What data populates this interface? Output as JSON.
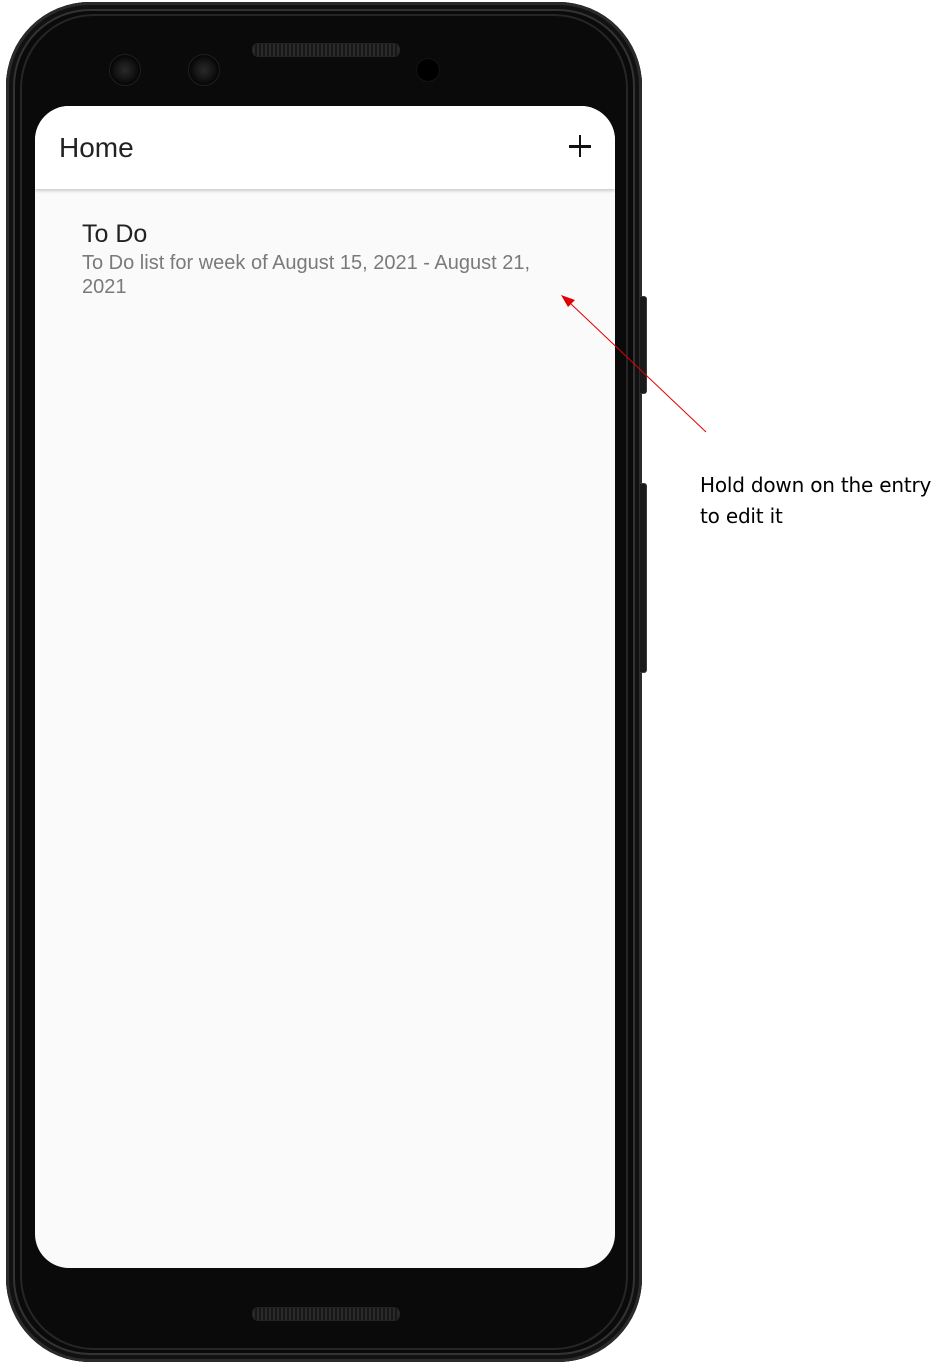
{
  "app_bar": {
    "title": "Home",
    "add_icon": "plus-icon"
  },
  "list": {
    "items": [
      {
        "title": "To Do",
        "subtitle": "To Do list for week of August 15, 2021 - August 21, 2021"
      }
    ]
  },
  "annotation": {
    "text": "Hold down on the entry to edit it",
    "arrow_color": "#e00000"
  },
  "colors": {
    "screen_background": "#fafafa",
    "app_bar_background": "#ffffff",
    "phone_body": "#0a0a0a",
    "subtitle_text": "#7a7a7a"
  }
}
